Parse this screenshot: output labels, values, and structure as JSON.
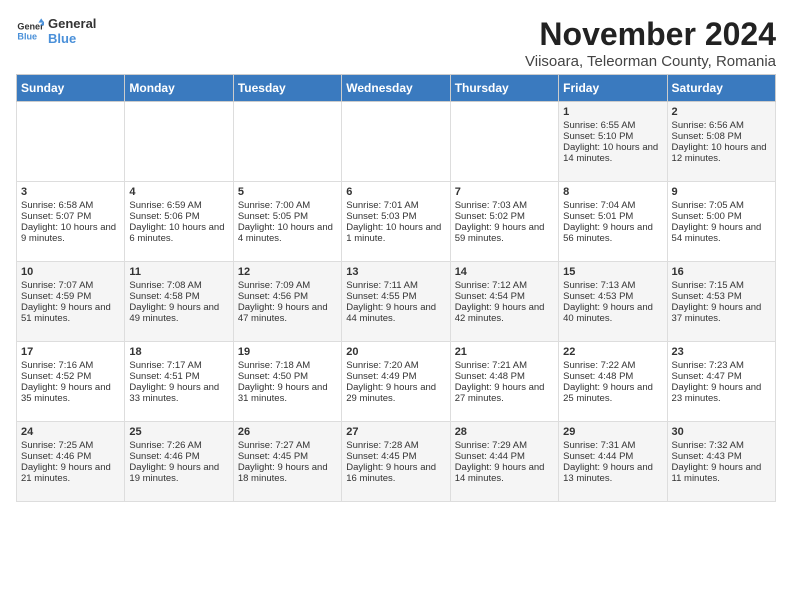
{
  "logo": {
    "line1": "General",
    "line2": "Blue"
  },
  "title": "November 2024",
  "subtitle": "Viisoara, Teleorman County, Romania",
  "days_header": [
    "Sunday",
    "Monday",
    "Tuesday",
    "Wednesday",
    "Thursday",
    "Friday",
    "Saturday"
  ],
  "weeks": [
    [
      {
        "day": "",
        "info": ""
      },
      {
        "day": "",
        "info": ""
      },
      {
        "day": "",
        "info": ""
      },
      {
        "day": "",
        "info": ""
      },
      {
        "day": "",
        "info": ""
      },
      {
        "day": "1",
        "info": "Sunrise: 6:55 AM\nSunset: 5:10 PM\nDaylight: 10 hours and 14 minutes."
      },
      {
        "day": "2",
        "info": "Sunrise: 6:56 AM\nSunset: 5:08 PM\nDaylight: 10 hours and 12 minutes."
      }
    ],
    [
      {
        "day": "3",
        "info": "Sunrise: 6:58 AM\nSunset: 5:07 PM\nDaylight: 10 hours and 9 minutes."
      },
      {
        "day": "4",
        "info": "Sunrise: 6:59 AM\nSunset: 5:06 PM\nDaylight: 10 hours and 6 minutes."
      },
      {
        "day": "5",
        "info": "Sunrise: 7:00 AM\nSunset: 5:05 PM\nDaylight: 10 hours and 4 minutes."
      },
      {
        "day": "6",
        "info": "Sunrise: 7:01 AM\nSunset: 5:03 PM\nDaylight: 10 hours and 1 minute."
      },
      {
        "day": "7",
        "info": "Sunrise: 7:03 AM\nSunset: 5:02 PM\nDaylight: 9 hours and 59 minutes."
      },
      {
        "day": "8",
        "info": "Sunrise: 7:04 AM\nSunset: 5:01 PM\nDaylight: 9 hours and 56 minutes."
      },
      {
        "day": "9",
        "info": "Sunrise: 7:05 AM\nSunset: 5:00 PM\nDaylight: 9 hours and 54 minutes."
      }
    ],
    [
      {
        "day": "10",
        "info": "Sunrise: 7:07 AM\nSunset: 4:59 PM\nDaylight: 9 hours and 51 minutes."
      },
      {
        "day": "11",
        "info": "Sunrise: 7:08 AM\nSunset: 4:58 PM\nDaylight: 9 hours and 49 minutes."
      },
      {
        "day": "12",
        "info": "Sunrise: 7:09 AM\nSunset: 4:56 PM\nDaylight: 9 hours and 47 minutes."
      },
      {
        "day": "13",
        "info": "Sunrise: 7:11 AM\nSunset: 4:55 PM\nDaylight: 9 hours and 44 minutes."
      },
      {
        "day": "14",
        "info": "Sunrise: 7:12 AM\nSunset: 4:54 PM\nDaylight: 9 hours and 42 minutes."
      },
      {
        "day": "15",
        "info": "Sunrise: 7:13 AM\nSunset: 4:53 PM\nDaylight: 9 hours and 40 minutes."
      },
      {
        "day": "16",
        "info": "Sunrise: 7:15 AM\nSunset: 4:53 PM\nDaylight: 9 hours and 37 minutes."
      }
    ],
    [
      {
        "day": "17",
        "info": "Sunrise: 7:16 AM\nSunset: 4:52 PM\nDaylight: 9 hours and 35 minutes."
      },
      {
        "day": "18",
        "info": "Sunrise: 7:17 AM\nSunset: 4:51 PM\nDaylight: 9 hours and 33 minutes."
      },
      {
        "day": "19",
        "info": "Sunrise: 7:18 AM\nSunset: 4:50 PM\nDaylight: 9 hours and 31 minutes."
      },
      {
        "day": "20",
        "info": "Sunrise: 7:20 AM\nSunset: 4:49 PM\nDaylight: 9 hours and 29 minutes."
      },
      {
        "day": "21",
        "info": "Sunrise: 7:21 AM\nSunset: 4:48 PM\nDaylight: 9 hours and 27 minutes."
      },
      {
        "day": "22",
        "info": "Sunrise: 7:22 AM\nSunset: 4:48 PM\nDaylight: 9 hours and 25 minutes."
      },
      {
        "day": "23",
        "info": "Sunrise: 7:23 AM\nSunset: 4:47 PM\nDaylight: 9 hours and 23 minutes."
      }
    ],
    [
      {
        "day": "24",
        "info": "Sunrise: 7:25 AM\nSunset: 4:46 PM\nDaylight: 9 hours and 21 minutes."
      },
      {
        "day": "25",
        "info": "Sunrise: 7:26 AM\nSunset: 4:46 PM\nDaylight: 9 hours and 19 minutes."
      },
      {
        "day": "26",
        "info": "Sunrise: 7:27 AM\nSunset: 4:45 PM\nDaylight: 9 hours and 18 minutes."
      },
      {
        "day": "27",
        "info": "Sunrise: 7:28 AM\nSunset: 4:45 PM\nDaylight: 9 hours and 16 minutes."
      },
      {
        "day": "28",
        "info": "Sunrise: 7:29 AM\nSunset: 4:44 PM\nDaylight: 9 hours and 14 minutes."
      },
      {
        "day": "29",
        "info": "Sunrise: 7:31 AM\nSunset: 4:44 PM\nDaylight: 9 hours and 13 minutes."
      },
      {
        "day": "30",
        "info": "Sunrise: 7:32 AM\nSunset: 4:43 PM\nDaylight: 9 hours and 11 minutes."
      }
    ]
  ]
}
